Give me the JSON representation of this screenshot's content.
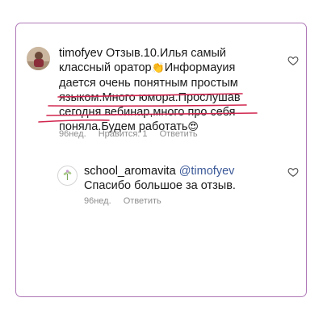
{
  "comment": {
    "username": "timofyev",
    "text_line1": " Отзыв.10.Илья самый",
    "text_line2": "классный оратор",
    "text_line2b": "Информауия",
    "text_line3": "дается  очень понятным простым",
    "text_line4": "языком.Много юмора.Прослушав",
    "text_line5": "сегодня вебинар,много про себя",
    "text_line6": "поняла.Будем работать",
    "time": "96нед.",
    "likes": "Нравится: 1",
    "reply_label": "Ответить",
    "clap_emoji": "👏",
    "love_emoji": "😍"
  },
  "reply": {
    "username": "school_aromavita",
    "mention": "@timofyev",
    "text": "Спасибо большое за отзыв.",
    "time": "96нед.",
    "reply_label": "Ответить"
  },
  "icons": {
    "like_icon": "heart-outline",
    "accent_color": "#b07ab8",
    "underline_color": "#d1264f"
  }
}
